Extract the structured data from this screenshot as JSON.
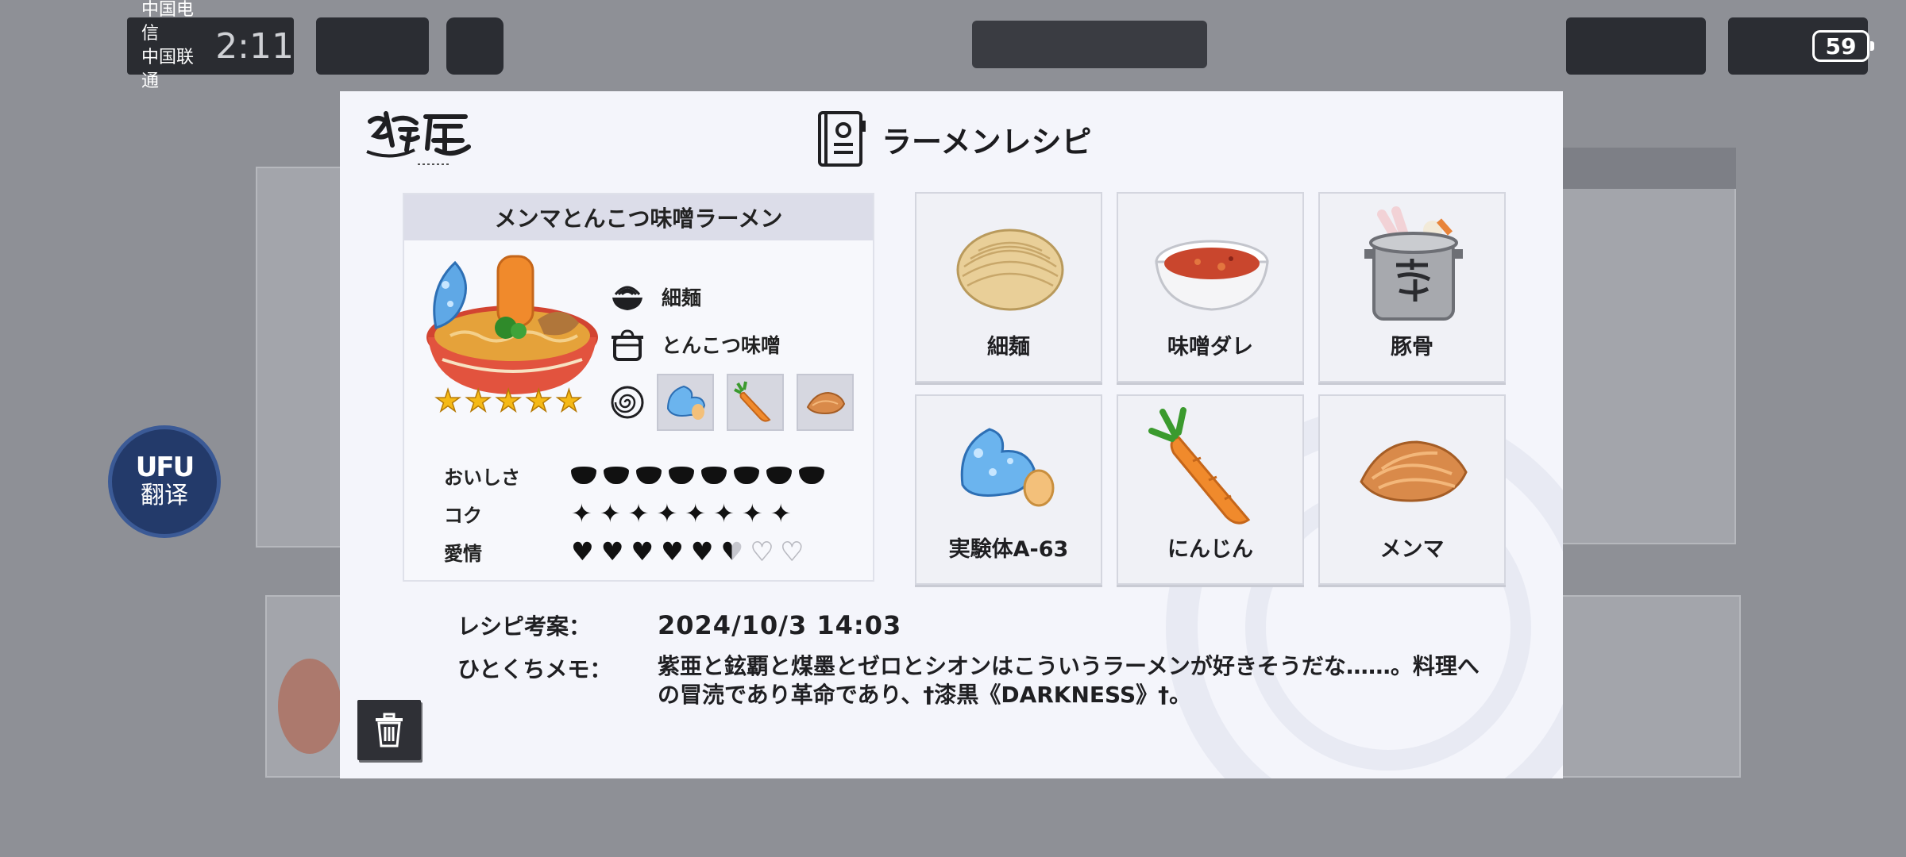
{
  "status": {
    "carrier_1": "中国电信",
    "carrier_2": "中国联通",
    "time": "2:11",
    "battery": "59"
  },
  "translate_button": {
    "logo": "UFU",
    "label": "翻译"
  },
  "modal": {
    "title": "ラーメンレシピ",
    "recipe": {
      "name": "メンマとんこつ味噌ラーメン",
      "stars": 5,
      "noodle": "細麺",
      "soup": "とんこつ味噌",
      "stats": [
        {
          "label": "おいしさ",
          "value": 8,
          "max": 8
        },
        {
          "label": "コク",
          "value": 8,
          "max": 8
        },
        {
          "label": "愛情",
          "value": 5.5,
          "max": 8
        }
      ]
    },
    "ingredients": [
      {
        "name": "細麺",
        "icon": "noodles-icon"
      },
      {
        "name": "味噌ダレ",
        "icon": "miso-sauce-icon"
      },
      {
        "name": "豚骨",
        "icon": "pork-bone-pot-icon"
      },
      {
        "name": "実験体A-63",
        "icon": "blue-creature-icon"
      },
      {
        "name": "にんじん",
        "icon": "carrot-icon"
      },
      {
        "name": "メンマ",
        "icon": "menma-icon"
      }
    ],
    "meta": {
      "date_label": "レシピ考案：",
      "date_value": "2024/10/3  14:03",
      "memo_label": "ひとくちメモ：",
      "memo_value": "紫亜と鉉覇と煤墨とゼロとシオンはこういうラーメンが好きそうだな……。料理への冒涜であり革命であり、†漆黒《DARKNESS》†。"
    }
  },
  "colors": {
    "modal_bg": "#f4f5fb",
    "star": "#f5b916",
    "translate_bg": "#233a6a"
  }
}
